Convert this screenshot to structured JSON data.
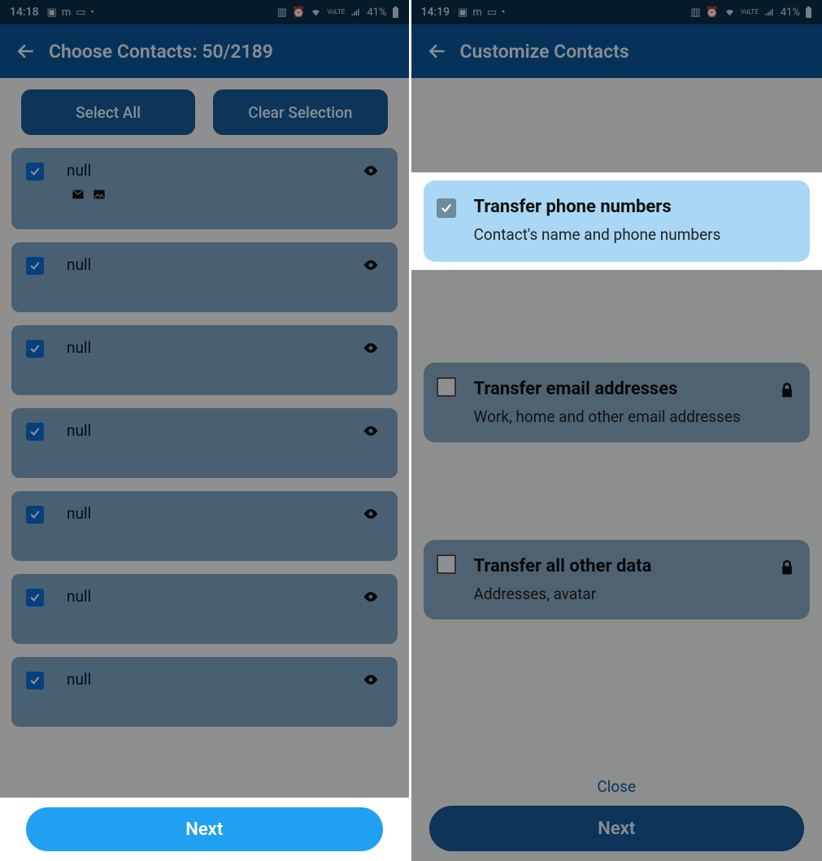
{
  "left": {
    "status": {
      "time": "14:18",
      "battery": "41%"
    },
    "appbar": {
      "title": "Choose Contacts:  50/2189"
    },
    "buttons": {
      "select_all": "Select All",
      "clear": "Clear Selection"
    },
    "contacts": [
      {
        "name": "null",
        "has_email": true,
        "has_photo": true
      },
      {
        "name": "null"
      },
      {
        "name": "null"
      },
      {
        "name": "null"
      },
      {
        "name": "null"
      },
      {
        "name": "null"
      },
      {
        "name": "null"
      }
    ],
    "next": "Next"
  },
  "right": {
    "status": {
      "time": "14:19",
      "battery": "41%"
    },
    "appbar": {
      "title": "Customize Contacts"
    },
    "options": [
      {
        "h": "Transfer phone numbers",
        "s": "Contact's name and phone numbers",
        "checked": true,
        "locked": false
      },
      {
        "h": "Transfer email addresses",
        "s": "Work, home and other email addresses",
        "checked": false,
        "locked": true
      },
      {
        "h": "Transfer all other data",
        "s": "Addresses, avatar",
        "checked": false,
        "locked": true
      }
    ],
    "close": "Close",
    "next": "Next"
  }
}
